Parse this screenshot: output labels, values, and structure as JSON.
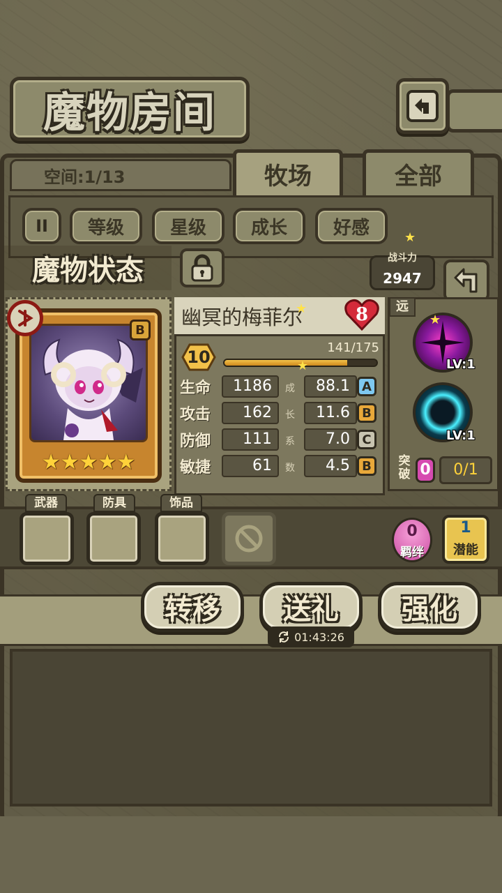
{
  "header": {
    "title": "魔物房间",
    "back_icon": "return-arrow-icon"
  },
  "room": {
    "space_text": "空间:1/13",
    "tabs": [
      {
        "label": "牧场",
        "active": true
      },
      {
        "label": "全部",
        "active": false
      }
    ]
  },
  "filters": {
    "pause_label": "II",
    "items": [
      "等级",
      "星级",
      "成长",
      "好感"
    ]
  },
  "status": {
    "title": "魔物状态",
    "lock_icon": "padlock-icon",
    "power_label": "战斗力",
    "power_value": "2947"
  },
  "monster": {
    "name": "幽冥的梅菲尔",
    "rank": "8",
    "type_icon": "element-type-icon",
    "grade": "B",
    "star_count": 5,
    "level": "10",
    "xp_text": "141/175",
    "xp_fraction": 0.806,
    "stats": [
      {
        "label": "生命",
        "value": "1186",
        "growth_char": "成",
        "growth": "88.1",
        "grade": "A",
        "grade_color": "#7ec8f0"
      },
      {
        "label": "攻击",
        "value": "162",
        "growth_char": "长",
        "growth": "11.6",
        "grade": "B",
        "grade_color": "#e8a83a"
      },
      {
        "label": "防御",
        "value": "111",
        "growth_char": "系",
        "growth": "7.0",
        "grade": "C",
        "grade_color": "#c8c4b0"
      },
      {
        "label": "敏捷",
        "value": "61",
        "growth_char": "数",
        "growth": "4.5",
        "grade": "B",
        "grade_color": "#e8a83a"
      }
    ]
  },
  "skills": {
    "range_tag": "远",
    "items": [
      {
        "lv": "LV:1",
        "icon": "dark-star-skill-icon"
      },
      {
        "lv": "LV:1",
        "icon": "cyan-ring-skill-icon"
      }
    ],
    "break_label_top": "突",
    "break_label_bottom": "破",
    "break_count": "0",
    "break_ratio": "0/1"
  },
  "equipment": {
    "slots": [
      "武器",
      "防具",
      "饰品"
    ],
    "bond_count": "0",
    "bond_label": "羁绊",
    "potential_count": "1",
    "potential_label": "潜能"
  },
  "actions": {
    "transfer": "转移",
    "gift": "送礼",
    "enhance": "强化",
    "timer": "01:43:26"
  }
}
